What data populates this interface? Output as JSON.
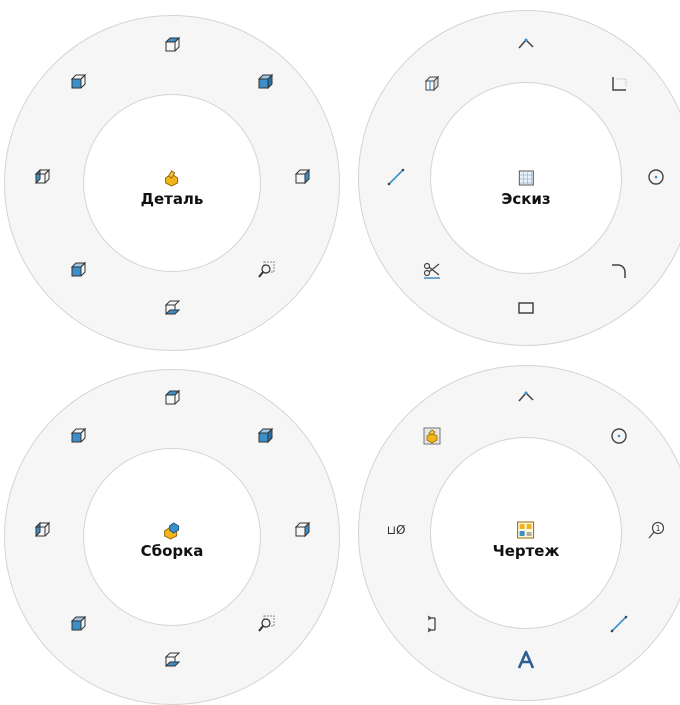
{
  "colors": {
    "ring_fill": "#f6f6f6",
    "ring_border": "#d4d4d4",
    "hub_fill": "#ffffff",
    "icon_blue": "#3d8fc9",
    "icon_yellow": "#f2b51c",
    "icon_dark": "#444444"
  },
  "wheels": [
    {
      "label": "Деталь",
      "center_icon": "part-icon",
      "items": [
        "top-view-icon",
        "right-view-icon",
        "back-view-icon",
        "left-view-icon",
        "front-view-icon",
        "isometric-view-icon",
        "bottom-view-icon",
        "zoom-to-area-icon"
      ]
    },
    {
      "label": "Эскиз",
      "center_icon": "sketch-icon",
      "items": [
        "line-chain-icon",
        "corner-rectangle-icon",
        "circle-icon",
        "fillet-arc-icon",
        "rectangle-icon",
        "trim-entities-icon",
        "line-icon",
        "view-orientation-icon"
      ]
    },
    {
      "label": "Сборка",
      "center_icon": "assembly-icon",
      "items": [
        "top-view-icon",
        "right-view-icon",
        "back-view-icon",
        "left-view-icon",
        "front-view-icon",
        "isometric-view-icon",
        "bottom-view-icon",
        "zoom-to-area-icon"
      ]
    },
    {
      "label": "Чертеж",
      "center_icon": "drawing-icon",
      "items": [
        "line-chain-icon",
        "circle-icon",
        "balloon-icon",
        "line-icon",
        "note-icon",
        "smart-dimension-icon",
        "hole-callout-icon",
        "model-view-icon"
      ],
      "hole_callout_text": "⊔Ø"
    }
  ]
}
